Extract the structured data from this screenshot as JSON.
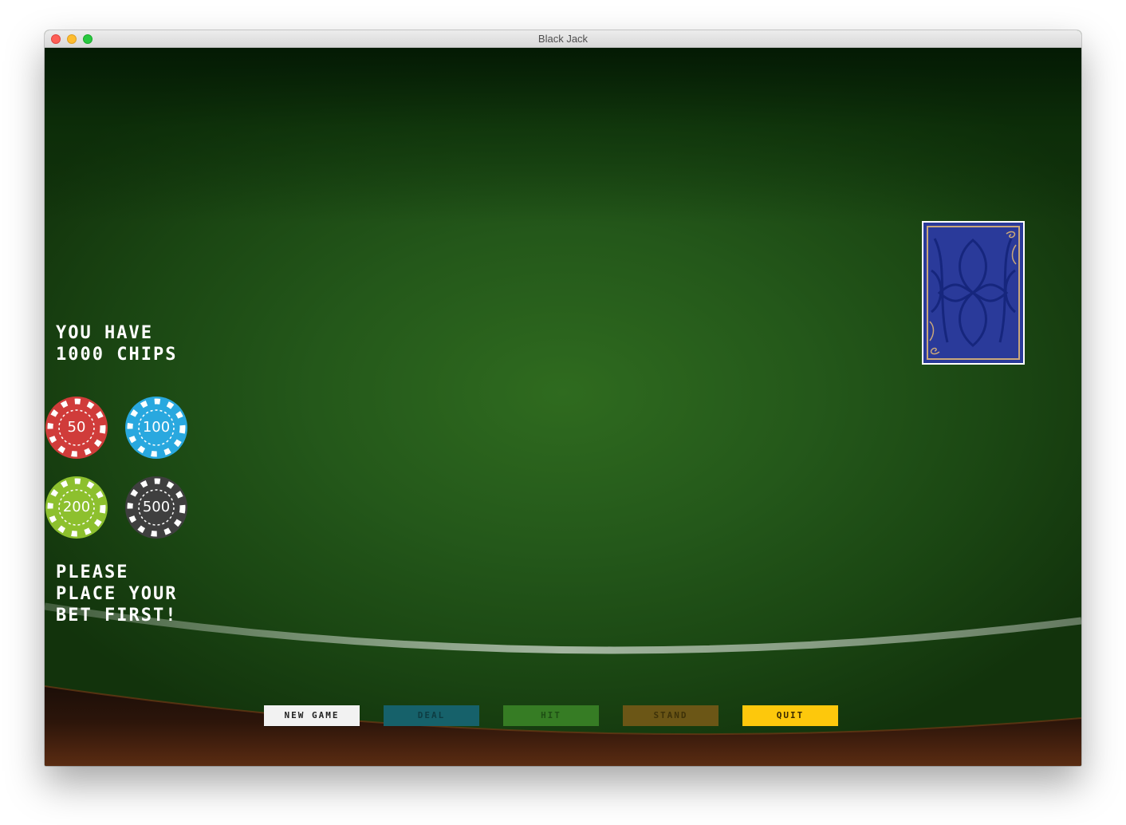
{
  "window": {
    "title": "Black Jack"
  },
  "player": {
    "chips_message": "You have\n1000 chips",
    "prompt": "Please\nplace your\nbet first!"
  },
  "chips": [
    {
      "value": "50",
      "color": "#d03c3a"
    },
    {
      "value": "100",
      "color": "#29a8df"
    },
    {
      "value": "200",
      "color": "#8dc02e"
    },
    {
      "value": "500",
      "color": "#3f3f3f"
    }
  ],
  "dealer": {
    "card_back_color": "#2a3a9a",
    "card_back_border": "#c9a77a"
  },
  "controls": {
    "new_game": "New Game",
    "deal": "Deal",
    "hit": "Hit",
    "stand": "Stand",
    "quit": "Quit"
  },
  "theme": {
    "felt": "#24581a",
    "wood": "#4a230f"
  }
}
